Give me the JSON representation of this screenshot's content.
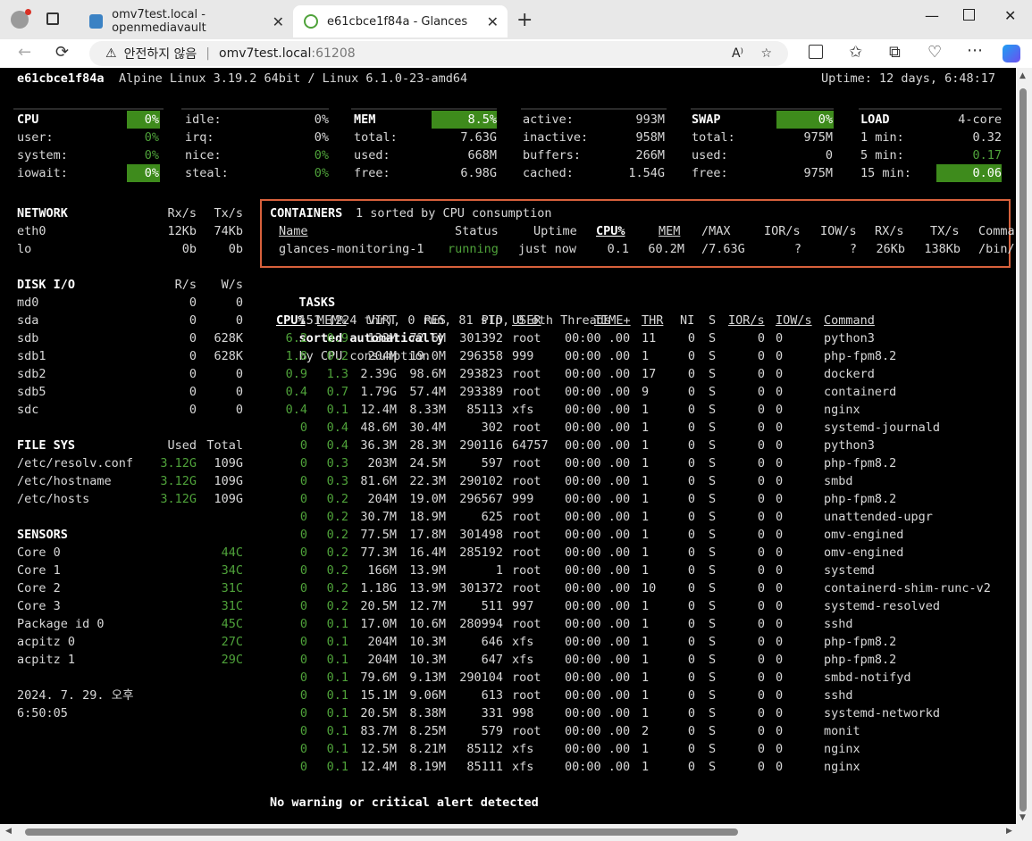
{
  "browser": {
    "tabs": [
      {
        "title": "omv7test.local - openmediavault"
      },
      {
        "title": "e61cbce1f84a - Glances"
      }
    ],
    "url_warning": "안전하지 않음",
    "url_host": "omv7test.local",
    "url_port": ":61208"
  },
  "header": {
    "hostname": "e61cbce1f84a",
    "sysinfo": "Alpine Linux 3.19.2 64bit / Linux 6.1.0-23-amd64",
    "uptime": "Uptime: 12 days, 6:48:17"
  },
  "cpu": {
    "title": "CPU",
    "total": "0%",
    "rows": [
      {
        "l": "user:",
        "v": "0%",
        "l2": "irq:",
        "v2": "0%"
      },
      {
        "l": "system:",
        "v": "0%",
        "l2": "nice:",
        "v2": "0%"
      },
      {
        "l": "iowait:",
        "v": "0%",
        "l2": "steal:",
        "v2": "0%"
      }
    ],
    "idle_label": "idle:",
    "idle": "0%"
  },
  "mem": {
    "title": "MEM",
    "total_pct": "8.5%",
    "rows": [
      {
        "l": "total:",
        "v": "7.63G"
      },
      {
        "l": "used:",
        "v": "668M"
      },
      {
        "l": "free:",
        "v": "6.98G"
      }
    ],
    "rows2": [
      {
        "l": "active:",
        "v": "993M"
      },
      {
        "l": "inactive:",
        "v": "958M"
      },
      {
        "l": "buffers:",
        "v": "266M"
      },
      {
        "l": "cached:",
        "v": "1.54G"
      }
    ]
  },
  "swap": {
    "title": "SWAP",
    "pct": "0%",
    "rows": [
      {
        "l": "total:",
        "v": "975M"
      },
      {
        "l": "used:",
        "v": "0"
      },
      {
        "l": "free:",
        "v": "975M"
      }
    ]
  },
  "load": {
    "title": "LOAD",
    "cores": "4-core",
    "rows": [
      {
        "l": "1 min:",
        "v": "0.32"
      },
      {
        "l": "5 min:",
        "v": "0.17"
      },
      {
        "l": "15 min:",
        "v": "0.06"
      }
    ]
  },
  "network": {
    "title": "NETWORK",
    "rx": "Rx/s",
    "tx": "Tx/s",
    "rows": [
      {
        "n": "eth0",
        "rx": "12Kb",
        "tx": "74Kb"
      },
      {
        "n": "lo",
        "rx": "0b",
        "tx": "0b"
      }
    ]
  },
  "diskio": {
    "title": "DISK I/O",
    "r": "R/s",
    "w": "W/s",
    "rows": [
      {
        "n": "md0",
        "r": "0",
        "w": "0"
      },
      {
        "n": "sda",
        "r": "0",
        "w": "0"
      },
      {
        "n": "sdb",
        "r": "0",
        "w": "628K"
      },
      {
        "n": "sdb1",
        "r": "0",
        "w": "628K"
      },
      {
        "n": "sdb2",
        "r": "0",
        "w": "0"
      },
      {
        "n": "sdb5",
        "r": "0",
        "w": "0"
      },
      {
        "n": "sdc",
        "r": "0",
        "w": "0"
      }
    ]
  },
  "filesys": {
    "title": "FILE SYS",
    "used": "Used",
    "total": "Total",
    "rows": [
      {
        "n": "/etc/resolv.conf",
        "u": "3.12G",
        "t": "109G"
      },
      {
        "n": "/etc/hostname",
        "u": "3.12G",
        "t": "109G"
      },
      {
        "n": "/etc/hosts",
        "u": "3.12G",
        "t": "109G"
      }
    ]
  },
  "sensors": {
    "title": "SENSORS",
    "rows": [
      {
        "n": "Core 0",
        "v": "44C"
      },
      {
        "n": "Core 1",
        "v": "34C"
      },
      {
        "n": "Core 2",
        "v": "31C"
      },
      {
        "n": "Core 3",
        "v": "31C"
      },
      {
        "n": "Package id 0",
        "v": "45C"
      },
      {
        "n": "acpitz 0",
        "v": "27C"
      },
      {
        "n": "acpitz 1",
        "v": "29C"
      }
    ]
  },
  "datetime": {
    "line1": "2024. 7. 29. 오후",
    "line2": "6:50:05"
  },
  "containers": {
    "title": "CONTAINERS",
    "summary": "1 sorted by CPU consumption",
    "headers": {
      "name": "Name",
      "status": "Status",
      "uptime": "Uptime",
      "cpu": "CPU%",
      "mem": "MEM",
      "max": "/MAX",
      "ior": "IOR/s",
      "iow": "IOW/s",
      "rx": "RX/s",
      "tx": "TX/s",
      "cmd": "Comma"
    },
    "row": {
      "name": "glances-monitoring-1",
      "status": "running",
      "uptime": "just now",
      "cpu": "0.1",
      "mem": "60.2M",
      "max": "/7.63G",
      "ior": "?",
      "iow": "?",
      "rx": "26Kb",
      "tx": "138Kb",
      "cmd": "/bin/"
    }
  },
  "tasks": {
    "title": "TASKS",
    "summary": "151 (224 thr), 0 run, 81 slp, 0 oth Threads",
    "sorted": "sorted automatically",
    "by": "by CPU consumption"
  },
  "proc_headers": {
    "cpu": "CPU%",
    "mem": "MEM%",
    "virt": "VIRT",
    "res": "RES",
    "pid": "PID",
    "user": "USER",
    "time": "TIME+",
    "thr": "THR",
    "ni": "NI",
    "s": "S",
    "ior": "IOR/s",
    "iow": "IOW/s",
    "cmd": "Command"
  },
  "processes": [
    {
      "cpu": "6.2",
      "mem": "0.9",
      "virt": "132M",
      "res": "72.6M",
      "pid": "301392",
      "user": "root",
      "time": "00:00 .00",
      "thr": "11",
      "ni": "0",
      "s": "S",
      "ior": "0",
      "iow": "0",
      "cmd": "python3"
    },
    {
      "cpu": "1.8",
      "mem": "0.2",
      "virt": "204M",
      "res": "19.0M",
      "pid": "296358",
      "user": "999",
      "time": "00:00 .00",
      "thr": "1",
      "ni": "0",
      "s": "S",
      "ior": "0",
      "iow": "0",
      "cmd": "php-fpm8.2"
    },
    {
      "cpu": "0.9",
      "mem": "1.3",
      "virt": "2.39G",
      "res": "98.6M",
      "pid": "293823",
      "user": "root",
      "time": "00:00 .00",
      "thr": "17",
      "ni": "0",
      "s": "S",
      "ior": "0",
      "iow": "0",
      "cmd": "dockerd"
    },
    {
      "cpu": "0.4",
      "mem": "0.7",
      "virt": "1.79G",
      "res": "57.4M",
      "pid": "293389",
      "user": "root",
      "time": "00:00 .00",
      "thr": "9",
      "ni": "0",
      "s": "S",
      "ior": "0",
      "iow": "0",
      "cmd": "containerd"
    },
    {
      "cpu": "0.4",
      "mem": "0.1",
      "virt": "12.4M",
      "res": "8.33M",
      "pid": "85113",
      "user": "xfs",
      "time": "00:00 .00",
      "thr": "1",
      "ni": "0",
      "s": "S",
      "ior": "0",
      "iow": "0",
      "cmd": "nginx"
    },
    {
      "cpu": "0",
      "mem": "0.4",
      "virt": "48.6M",
      "res": "30.4M",
      "pid": "302",
      "user": "root",
      "time": "00:00 .00",
      "thr": "1",
      "ni": "0",
      "s": "S",
      "ior": "0",
      "iow": "0",
      "cmd": "systemd-journald"
    },
    {
      "cpu": "0",
      "mem": "0.4",
      "virt": "36.3M",
      "res": "28.3M",
      "pid": "290116",
      "user": "64757",
      "time": "00:00 .00",
      "thr": "1",
      "ni": "0",
      "s": "S",
      "ior": "0",
      "iow": "0",
      "cmd": "python3"
    },
    {
      "cpu": "0",
      "mem": "0.3",
      "virt": "203M",
      "res": "24.5M",
      "pid": "597",
      "user": "root",
      "time": "00:00 .00",
      "thr": "1",
      "ni": "0",
      "s": "S",
      "ior": "0",
      "iow": "0",
      "cmd": "php-fpm8.2"
    },
    {
      "cpu": "0",
      "mem": "0.3",
      "virt": "81.6M",
      "res": "22.3M",
      "pid": "290102",
      "user": "root",
      "time": "00:00 .00",
      "thr": "1",
      "ni": "0",
      "s": "S",
      "ior": "0",
      "iow": "0",
      "cmd": "smbd"
    },
    {
      "cpu": "0",
      "mem": "0.2",
      "virt": "204M",
      "res": "19.0M",
      "pid": "296567",
      "user": "999",
      "time": "00:00 .00",
      "thr": "1",
      "ni": "0",
      "s": "S",
      "ior": "0",
      "iow": "0",
      "cmd": "php-fpm8.2"
    },
    {
      "cpu": "0",
      "mem": "0.2",
      "virt": "30.7M",
      "res": "18.9M",
      "pid": "625",
      "user": "root",
      "time": "00:00 .00",
      "thr": "1",
      "ni": "0",
      "s": "S",
      "ior": "0",
      "iow": "0",
      "cmd": "unattended-upgr"
    },
    {
      "cpu": "0",
      "mem": "0.2",
      "virt": "77.5M",
      "res": "17.8M",
      "pid": "301498",
      "user": "root",
      "time": "00:00 .00",
      "thr": "1",
      "ni": "0",
      "s": "S",
      "ior": "0",
      "iow": "0",
      "cmd": "omv-engined"
    },
    {
      "cpu": "0",
      "mem": "0.2",
      "virt": "77.3M",
      "res": "16.4M",
      "pid": "285192",
      "user": "root",
      "time": "00:00 .00",
      "thr": "1",
      "ni": "0",
      "s": "S",
      "ior": "0",
      "iow": "0",
      "cmd": "omv-engined"
    },
    {
      "cpu": "0",
      "mem": "0.2",
      "virt": "166M",
      "res": "13.9M",
      "pid": "1",
      "user": "root",
      "time": "00:00 .00",
      "thr": "1",
      "ni": "0",
      "s": "S",
      "ior": "0",
      "iow": "0",
      "cmd": "systemd"
    },
    {
      "cpu": "0",
      "mem": "0.2",
      "virt": "1.18G",
      "res": "13.9M",
      "pid": "301372",
      "user": "root",
      "time": "00:00 .00",
      "thr": "10",
      "ni": "0",
      "s": "S",
      "ior": "0",
      "iow": "0",
      "cmd": "containerd-shim-runc-v2"
    },
    {
      "cpu": "0",
      "mem": "0.2",
      "virt": "20.5M",
      "res": "12.7M",
      "pid": "511",
      "user": "997",
      "time": "00:00 .00",
      "thr": "1",
      "ni": "0",
      "s": "S",
      "ior": "0",
      "iow": "0",
      "cmd": "systemd-resolved"
    },
    {
      "cpu": "0",
      "mem": "0.1",
      "virt": "17.0M",
      "res": "10.6M",
      "pid": "280994",
      "user": "root",
      "time": "00:00 .00",
      "thr": "1",
      "ni": "0",
      "s": "S",
      "ior": "0",
      "iow": "0",
      "cmd": "sshd"
    },
    {
      "cpu": "0",
      "mem": "0.1",
      "virt": "204M",
      "res": "10.3M",
      "pid": "646",
      "user": "xfs",
      "time": "00:00 .00",
      "thr": "1",
      "ni": "0",
      "s": "S",
      "ior": "0",
      "iow": "0",
      "cmd": "php-fpm8.2"
    },
    {
      "cpu": "0",
      "mem": "0.1",
      "virt": "204M",
      "res": "10.3M",
      "pid": "647",
      "user": "xfs",
      "time": "00:00 .00",
      "thr": "1",
      "ni": "0",
      "s": "S",
      "ior": "0",
      "iow": "0",
      "cmd": "php-fpm8.2"
    },
    {
      "cpu": "0",
      "mem": "0.1",
      "virt": "79.6M",
      "res": "9.13M",
      "pid": "290104",
      "user": "root",
      "time": "00:00 .00",
      "thr": "1",
      "ni": "0",
      "s": "S",
      "ior": "0",
      "iow": "0",
      "cmd": "smbd-notifyd"
    },
    {
      "cpu": "0",
      "mem": "0.1",
      "virt": "15.1M",
      "res": "9.06M",
      "pid": "613",
      "user": "root",
      "time": "00:00 .00",
      "thr": "1",
      "ni": "0",
      "s": "S",
      "ior": "0",
      "iow": "0",
      "cmd": "sshd"
    },
    {
      "cpu": "0",
      "mem": "0.1",
      "virt": "20.5M",
      "res": "8.38M",
      "pid": "331",
      "user": "998",
      "time": "00:00 .00",
      "thr": "1",
      "ni": "0",
      "s": "S",
      "ior": "0",
      "iow": "0",
      "cmd": "systemd-networkd"
    },
    {
      "cpu": "0",
      "mem": "0.1",
      "virt": "83.7M",
      "res": "8.25M",
      "pid": "579",
      "user": "root",
      "time": "00:00 .00",
      "thr": "2",
      "ni": "0",
      "s": "S",
      "ior": "0",
      "iow": "0",
      "cmd": "monit"
    },
    {
      "cpu": "0",
      "mem": "0.1",
      "virt": "12.5M",
      "res": "8.21M",
      "pid": "85112",
      "user": "xfs",
      "time": "00:00 .00",
      "thr": "1",
      "ni": "0",
      "s": "S",
      "ior": "0",
      "iow": "0",
      "cmd": "nginx"
    },
    {
      "cpu": "0",
      "mem": "0.1",
      "virt": "12.4M",
      "res": "8.19M",
      "pid": "85111",
      "user": "xfs",
      "time": "00:00 .00",
      "thr": "1",
      "ni": "0",
      "s": "S",
      "ior": "0",
      "iow": "0",
      "cmd": "nginx"
    }
  ],
  "alert": "No warning or critical alert detected"
}
